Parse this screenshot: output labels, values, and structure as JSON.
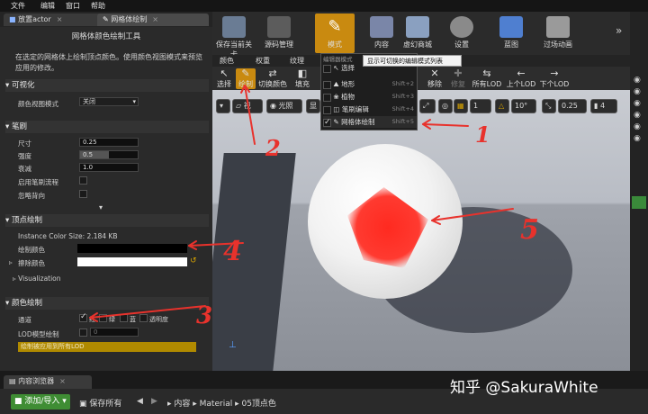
{
  "menubar": {
    "items": [
      "文件",
      "编辑",
      "窗口",
      "帮助"
    ]
  },
  "left_tabs": [
    {
      "label": "放置actor"
    },
    {
      "label": "网格体绘制"
    }
  ],
  "panel": {
    "title": "网格体颜色绘制工具",
    "description": "在选定的网格体上绘制顶点颜色。使用颜色视图模式来预览应用的修改。",
    "visualization": {
      "header": "可视化",
      "color_view_mode_label": "颜色视图模式",
      "color_view_mode_value": "关闭"
    },
    "brush": {
      "header": "笔刷",
      "size_label": "尺寸",
      "size_value": "0.25",
      "strength_label": "强度",
      "strength_value": "0.5",
      "strength_fill": 0.5,
      "falloff_label": "衰减",
      "falloff_value": "1.0",
      "enable_flow_label": "启用笔刷流程",
      "ignore_backface_label": "忽略背向"
    },
    "vertex_paint": {
      "header": "顶点绘制",
      "instance_size": "Instance Color Size: 2.184 KB",
      "paint_color_label": "绘制颜色",
      "paint_color": "#000000",
      "erase_color_label": "擦除颜色",
      "erase_color": "#ffffff",
      "visualization_label": "Visualization"
    },
    "color_paint": {
      "header": "颜色绘制",
      "channels_label": "通道",
      "channels": [
        "红",
        "绿",
        "蓝",
        "透明度"
      ],
      "lod_label": "LOD模型绘制",
      "lod_value": "0",
      "apply_button": "绘制被应用到所有LOD"
    }
  },
  "top_toolbar": {
    "items": [
      {
        "label": "保存当前关卡",
        "icon": "save-icon"
      },
      {
        "label": "源码管理",
        "icon": "source-control-icon"
      },
      {
        "label": "模式",
        "icon": "modes-icon"
      },
      {
        "label": "内容",
        "icon": "content-icon"
      },
      {
        "label": "虚幻商城",
        "icon": "marketplace-icon"
      },
      {
        "label": "设置",
        "icon": "settings-icon"
      },
      {
        "label": "蓝图",
        "icon": "blueprint-icon"
      },
      {
        "label": "过场动画",
        "icon": "cinematics-icon"
      }
    ],
    "overflow": "»"
  },
  "mode_tabs": [
    "颜色",
    "权重",
    "纹理"
  ],
  "subtools": [
    {
      "label": "选择",
      "glyph": "↖"
    },
    {
      "label": "绘制",
      "glyph": "✎"
    },
    {
      "label": "切换颜色",
      "glyph": "⇄"
    },
    {
      "label": "填充",
      "glyph": "◧"
    }
  ],
  "subtools_right": [
    {
      "label": "移除",
      "glyph": "✕"
    },
    {
      "label": "修复",
      "glyph": "✚"
    },
    {
      "label": "所有LOD",
      "glyph": "⇆"
    },
    {
      "label": "上个LOD",
      "glyph": "←"
    },
    {
      "label": "下个LOD",
      "glyph": "→"
    }
  ],
  "mode_dropdown": {
    "header": "编辑器模式",
    "items": [
      {
        "label": "选择",
        "shortcut": ""
      },
      {
        "label": "地形",
        "shortcut": "Shift+2"
      },
      {
        "label": "植物",
        "shortcut": "Shift+3"
      },
      {
        "label": "笔刷编辑",
        "shortcut": "Shift+4"
      },
      {
        "label": "网格体绘制",
        "shortcut": "Shift+5"
      }
    ],
    "checked_index": 4
  },
  "tooltip": "显示可切换的编辑模式列表",
  "viewport_toolbar": {
    "view_label": "视",
    "lit_label": "光照",
    "show_label": "显",
    "grid_value": "1",
    "angle_value": "10°",
    "scale_value": "0.25",
    "camera_speed": "4"
  },
  "annotations": [
    "1",
    "2",
    "3",
    "4",
    "5"
  ],
  "bottom": {
    "tab_label": "内容浏览器",
    "add_import": "添加/导入",
    "save_all": "保存所有",
    "breadcrumb": [
      "内容",
      "Material",
      "05顶点色"
    ]
  },
  "watermark": "知乎 @SakuraWhite"
}
